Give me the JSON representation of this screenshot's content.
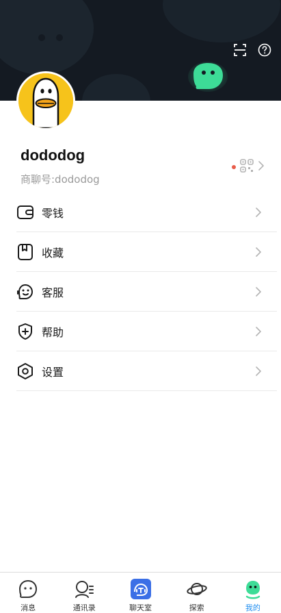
{
  "header": {
    "scan_icon": "scan-icon",
    "help_icon": "help-circle-icon"
  },
  "profile": {
    "username": "dododog",
    "user_id": "商聊号:dododog",
    "qr_icon": "qr-code-icon"
  },
  "menu": {
    "items": [
      {
        "label": "零钱",
        "icon": "wallet-icon"
      },
      {
        "label": "收藏",
        "icon": "bookmark-icon"
      },
      {
        "label": "客服",
        "icon": "customer-service-icon"
      },
      {
        "label": "帮助",
        "icon": "help-shield-icon"
      },
      {
        "label": "设置",
        "icon": "settings-hexagon-icon"
      }
    ]
  },
  "bottom_nav": {
    "items": [
      {
        "label": "消息",
        "icon": "message-icon",
        "active": false
      },
      {
        "label": "通讯录",
        "icon": "contacts-icon",
        "active": false
      },
      {
        "label": "聊天室",
        "icon": "chatroom-icon",
        "active": false
      },
      {
        "label": "探索",
        "icon": "planet-icon",
        "active": false
      },
      {
        "label": "我的",
        "icon": "me-icon",
        "active": true
      }
    ]
  },
  "colors": {
    "banner": "#141a22",
    "accent_green": "#3ddc97",
    "active_blue": "#1f8ef0",
    "notice_red": "#e85c4a",
    "avatar_yellow": "#f6c31b"
  }
}
